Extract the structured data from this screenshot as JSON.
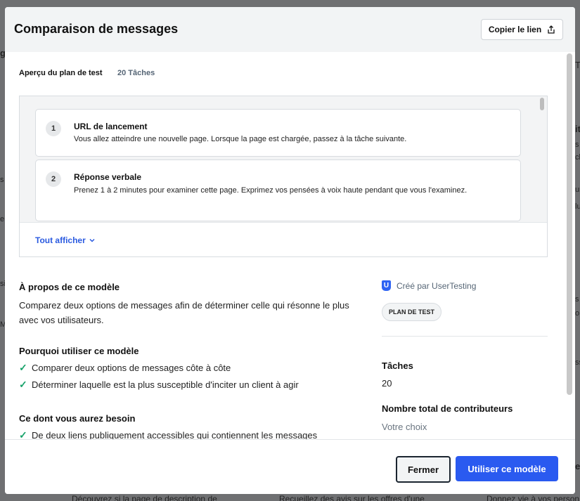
{
  "background": {
    "left_fragments": [
      "g",
      "s",
      "e",
      "si",
      "M"
    ],
    "right_fragments": [
      "T",
      "its",
      "s",
      "cli",
      "ur",
      "lu",
      "s",
      "o",
      "ss",
      "es"
    ],
    "bottom_fragments": [
      "Découvrez si la page de description de",
      "Recueillez des avis sur les offres d'une",
      "Donnez vie à vos person"
    ]
  },
  "modal": {
    "title": "Comparaison de messages",
    "copy_link_label": "Copier le lien",
    "overview": {
      "title": "Aperçu du plan de test",
      "count": "20 Tâches"
    },
    "tasks": [
      {
        "number": "1",
        "title": "URL de lancement",
        "description": "Vous allez atteindre une nouvelle page. Lorsque la page est chargée, passez à la tâche suivante."
      },
      {
        "number": "2",
        "title": "Réponse verbale",
        "description": "Prenez 1 à 2 minutes pour examiner cette page. Exprimez vos pensées à voix haute pendant que vous l'examinez."
      }
    ],
    "show_all_label": "Tout afficher",
    "about": {
      "title": "À propos de ce modèle",
      "text": "Comparez deux options de messages afin de déterminer celle qui résonne le plus avec vos utilisateurs."
    },
    "why": {
      "title": "Pourquoi utiliser ce modèle",
      "items": [
        "Comparer deux options de messages côte à côte",
        "Déterminer laquelle est la plus susceptible d'inciter un client à agir"
      ]
    },
    "need": {
      "title": "Ce dont vous aurez besoin",
      "items": [
        "De deux liens publiquement accessibles qui contiennent les messages"
      ]
    },
    "sidebar": {
      "creator_logo": "U",
      "creator": "Créé par UserTesting",
      "badge": "PLAN DE TEST",
      "tasks_label": "Tâches",
      "tasks_value": "20",
      "contributors_label": "Nombre total de contributeurs",
      "contributors_value": "Votre choix"
    },
    "footer": {
      "close_label": "Fermer",
      "use_label": "Utiliser ce modèle"
    }
  },
  "colors": {
    "accent": "#2a5af0",
    "check": "#18a36b",
    "header_bg": "#f2f4f5"
  }
}
